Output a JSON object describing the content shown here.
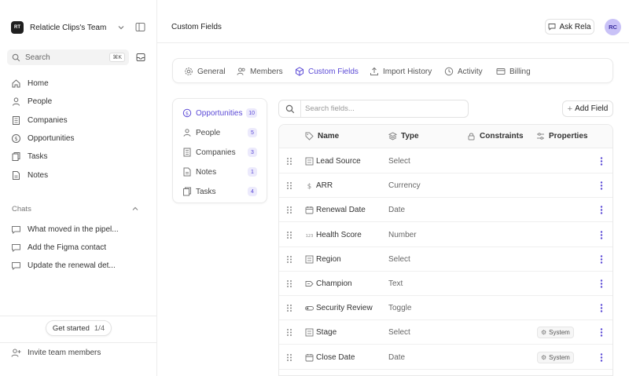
{
  "team": {
    "logo": "RT",
    "name": "Relaticle Clips's Team"
  },
  "search": {
    "placeholder": "Search",
    "shortcut": "⌘K"
  },
  "nav": [
    {
      "label": "Home",
      "icon": "home-icon"
    },
    {
      "label": "People",
      "icon": "person-icon"
    },
    {
      "label": "Companies",
      "icon": "building-icon"
    },
    {
      "label": "Opportunities",
      "icon": "dollar-icon"
    },
    {
      "label": "Tasks",
      "icon": "tasks-icon"
    },
    {
      "label": "Notes",
      "icon": "note-icon"
    }
  ],
  "chats": {
    "header": "Chats",
    "items": [
      "What moved in the pipel...",
      "Add the Figma contact",
      "Update the renewal det..."
    ]
  },
  "get_started": {
    "label": "Get started",
    "count": "1/4"
  },
  "invite": {
    "label": "Invite team members"
  },
  "header": {
    "title": "Custom Fields",
    "ask_label": "Ask Rela",
    "avatar": "RC"
  },
  "tabs": [
    {
      "label": "General",
      "icon": "gear-icon",
      "active": false
    },
    {
      "label": "Members",
      "icon": "users-icon",
      "active": false
    },
    {
      "label": "Custom Fields",
      "icon": "cube-icon",
      "active": true
    },
    {
      "label": "Import History",
      "icon": "upload-icon",
      "active": false
    },
    {
      "label": "Activity",
      "icon": "clock-icon",
      "active": false
    },
    {
      "label": "Billing",
      "icon": "card-icon",
      "active": false
    }
  ],
  "objects": [
    {
      "label": "Opportunities",
      "count": "10",
      "icon": "dollar-icon",
      "active": true
    },
    {
      "label": "People",
      "count": "5",
      "icon": "person-icon",
      "active": false
    },
    {
      "label": "Companies",
      "count": "3",
      "icon": "building-icon",
      "active": false
    },
    {
      "label": "Notes",
      "count": "1",
      "icon": "note-icon",
      "active": false
    },
    {
      "label": "Tasks",
      "count": "4",
      "icon": "tasks-icon",
      "active": false
    }
  ],
  "field_search": {
    "placeholder": "Search fields..."
  },
  "add_field_label": "Add Field",
  "columns": {
    "name": "Name",
    "type": "Type",
    "constraints": "Constraints",
    "properties": "Properties"
  },
  "fields": [
    {
      "name": "Lead Source",
      "type": "Select",
      "icon": "select-icon",
      "badge": ""
    },
    {
      "name": "ARR",
      "type": "Currency",
      "icon": "currency-icon",
      "badge": ""
    },
    {
      "name": "Renewal Date",
      "type": "Date",
      "icon": "calendar-icon",
      "badge": ""
    },
    {
      "name": "Health Score",
      "type": "Number",
      "icon": "number-icon",
      "badge": ""
    },
    {
      "name": "Region",
      "type": "Select",
      "icon": "select-icon",
      "badge": ""
    },
    {
      "name": "Champion",
      "type": "Text",
      "icon": "text-icon",
      "badge": ""
    },
    {
      "name": "Security Review",
      "type": "Toggle",
      "icon": "toggle-icon",
      "badge": ""
    },
    {
      "name": "Stage",
      "type": "Select",
      "icon": "select-icon",
      "badge": "System"
    },
    {
      "name": "Close Date",
      "type": "Date",
      "icon": "calendar-icon",
      "badge": "System"
    }
  ],
  "colors": {
    "accent": "#5b4ad6",
    "badge_bg": "#eceafc",
    "avatar_bg": "#c9c2f7"
  }
}
